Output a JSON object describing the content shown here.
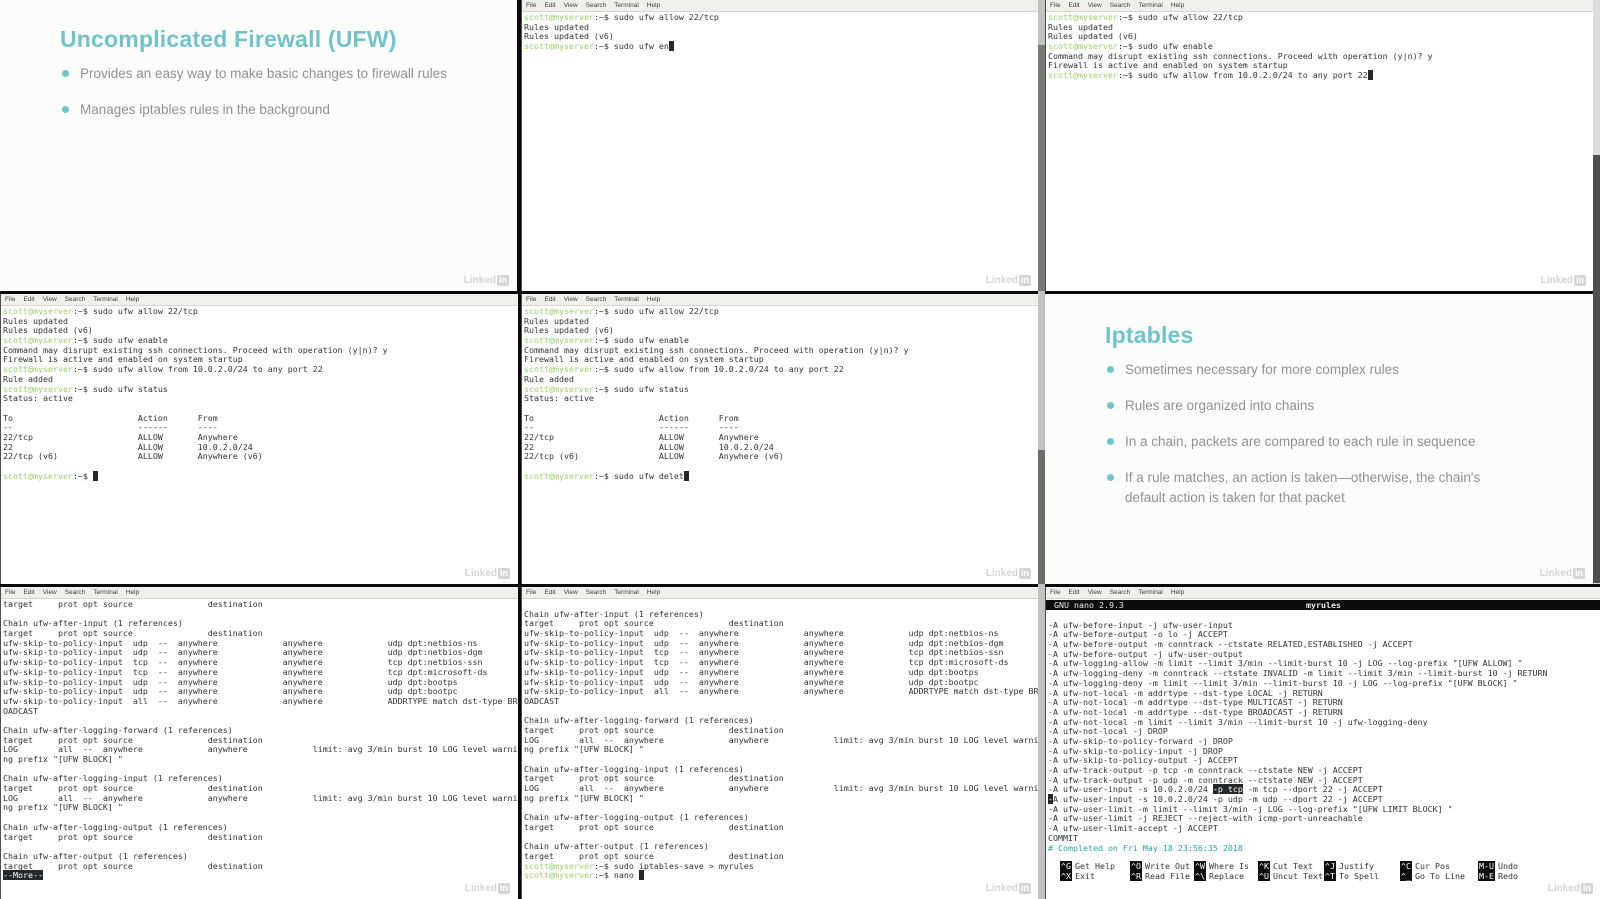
{
  "colors": {
    "slide_accent_teal": "#70c3cb",
    "prompt_green": "#9ccf6d",
    "nano_comment_teal": "#2aa6a0",
    "slide_body_gray": "#8d9292"
  },
  "watermark": {
    "text": "Linked",
    "badge": "in"
  },
  "menu": [
    "File",
    "Edit",
    "View",
    "Search",
    "Terminal",
    "Help"
  ],
  "slides": {
    "ufw": {
      "title": "Uncomplicated Firewall (UFW)",
      "bullets": [
        "Provides an easy way to make basic changes to firewall rules",
        "Manages iptables rules in the background"
      ]
    },
    "iptables": {
      "title": "Iptables",
      "bullets": [
        "Sometimes necessary for more complex rules",
        "Rules are organized into chains",
        "In a chain, packets are compared to each rule in sequence",
        "If a rule matches, an action is taken—otherwise, the chain's default action is taken for that packet"
      ]
    }
  },
  "terminals": {
    "t1": {
      "lines": [
        [
          {
            "t": "scott@myserver",
            "c": "g"
          },
          ":~$ sudo ufw allow 22/tcp"
        ],
        [
          "Rules updated"
        ],
        [
          "Rules updated (v6)"
        ],
        [
          {
            "t": "scott@myserver",
            "c": "g"
          },
          ":~$ sudo ufw en",
          {
            "t": " ",
            "c": "inv"
          }
        ]
      ]
    },
    "t2": {
      "lines": [
        [
          {
            "t": "scott@myserver",
            "c": "g"
          },
          ":~$ sudo ufw allow 22/tcp"
        ],
        [
          "Rules updated"
        ],
        [
          "Rules updated (v6)"
        ],
        [
          {
            "t": "scott@myserver",
            "c": "g"
          },
          ":~$ sudo ufw enable"
        ],
        [
          "Command may disrupt existing ssh connections. Proceed with operation (y|n)? y"
        ],
        [
          "Firewall is active and enabled on system startup"
        ],
        [
          {
            "t": "scott@myserver",
            "c": "g"
          },
          ":~$ sudo ufw allow from 10.0.2.0/24 to any port 22",
          {
            "t": " ",
            "c": "inv"
          }
        ]
      ]
    },
    "t3": {
      "lines": [
        [
          {
            "t": "scott@myserver",
            "c": "g"
          },
          ":~$ sudo ufw allow 22/tcp"
        ],
        [
          "Rules updated"
        ],
        [
          "Rules updated (v6)"
        ],
        [
          {
            "t": "scott@myserver",
            "c": "g"
          },
          ":~$ sudo ufw enable"
        ],
        [
          "Command may disrupt existing ssh connections. Proceed with operation (y|n)? y"
        ],
        [
          "Firewall is active and enabled on system startup"
        ],
        [
          {
            "t": "scott@myserver",
            "c": "g"
          },
          ":~$ sudo ufw allow from 10.0.2.0/24 to any port 22"
        ],
        [
          "Rule added"
        ],
        [
          {
            "t": "scott@myserver",
            "c": "g"
          },
          ":~$ sudo ufw status"
        ],
        [
          "Status: active"
        ],
        [],
        [
          "To                         Action      From"
        ],
        [
          "--                         ------      ----"
        ],
        [
          "22/tcp                     ALLOW       Anywhere"
        ],
        [
          "22                         ALLOW       10.0.2.0/24"
        ],
        [
          "22/tcp (v6)                ALLOW       Anywhere (v6)"
        ],
        [],
        [
          {
            "t": "scott@myserver",
            "c": "g"
          },
          ":~$ ",
          {
            "t": " ",
            "c": "inv"
          }
        ]
      ]
    },
    "t4": {
      "lines": [
        [
          {
            "t": "scott@myserver",
            "c": "g"
          },
          ":~$ sudo ufw allow 22/tcp"
        ],
        [
          "Rules updated"
        ],
        [
          "Rules updated (v6)"
        ],
        [
          {
            "t": "scott@myserver",
            "c": "g"
          },
          ":~$ sudo ufw enable"
        ],
        [
          "Command may disrupt existing ssh connections. Proceed with operation (y|n)? y"
        ],
        [
          "Firewall is active and enabled on system startup"
        ],
        [
          {
            "t": "scott@myserver",
            "c": "g"
          },
          ":~$ sudo ufw allow from 10.0.2.0/24 to any port 22"
        ],
        [
          "Rule added"
        ],
        [
          {
            "t": "scott@myserver",
            "c": "g"
          },
          ":~$ sudo ufw status"
        ],
        [
          "Status: active"
        ],
        [],
        [
          "To                         Action      From"
        ],
        [
          "--                         ------      ----"
        ],
        [
          "22/tcp                     ALLOW       Anywhere"
        ],
        [
          "22                         ALLOW       10.0.2.0/24"
        ],
        [
          "22/tcp (v6)                ALLOW       Anywhere (v6)"
        ],
        [],
        [
          {
            "t": "scott@myserver",
            "c": "g"
          },
          ":~$ sudo ufw delet",
          {
            "t": " ",
            "c": "inv"
          }
        ]
      ]
    },
    "t5": {
      "lines": [
        [
          "target     prot opt source               destination"
        ],
        [],
        [
          "Chain ufw-after-input (1 references)"
        ],
        [
          "target     prot opt source               destination"
        ],
        [
          "ufw-skip-to-policy-input  udp  --  anywhere             anywhere             udp dpt:netbios-ns"
        ],
        [
          "ufw-skip-to-policy-input  udp  --  anywhere             anywhere             udp dpt:netbios-dgm"
        ],
        [
          "ufw-skip-to-policy-input  tcp  --  anywhere             anywhere             tcp dpt:netbios-ssn"
        ],
        [
          "ufw-skip-to-policy-input  tcp  --  anywhere             anywhere             tcp dpt:microsoft-ds"
        ],
        [
          "ufw-skip-to-policy-input  udp  --  anywhere             anywhere             udp dpt:bootps"
        ],
        [
          "ufw-skip-to-policy-input  udp  --  anywhere             anywhere             udp dpt:bootpc"
        ],
        [
          "ufw-skip-to-policy-input  all  --  anywhere             anywhere             ADDRTYPE match dst-type BR"
        ],
        [
          "OADCAST"
        ],
        [],
        [
          "Chain ufw-after-logging-forward (1 references)"
        ],
        [
          "target     prot opt source               destination"
        ],
        [
          "LOG        all  --  anywhere             anywhere             limit: avg 3/min burst 10 LOG level warni"
        ],
        [
          "ng prefix \"[UFW BLOCK] \""
        ],
        [],
        [
          "Chain ufw-after-logging-input (1 references)"
        ],
        [
          "target     prot opt source               destination"
        ],
        [
          "LOG        all  --  anywhere             anywhere             limit: avg 3/min burst 10 LOG level warni"
        ],
        [
          "ng prefix \"[UFW BLOCK] \""
        ],
        [],
        [
          "Chain ufw-after-logging-output (1 references)"
        ],
        [
          "target     prot opt source               destination"
        ],
        [],
        [
          "Chain ufw-after-output (1 references)"
        ],
        [
          "target     prot opt source               destination"
        ],
        [
          {
            "t": "--More--",
            "c": "inv"
          }
        ]
      ]
    },
    "t6": {
      "lines": [
        [],
        [
          "Chain ufw-after-input (1 references)"
        ],
        [
          "target     prot opt source               destination"
        ],
        [
          "ufw-skip-to-policy-input  udp  --  anywhere             anywhere             udp dpt:netbios-ns"
        ],
        [
          "ufw-skip-to-policy-input  udp  --  anywhere             anywhere             udp dpt:netbios-dgm"
        ],
        [
          "ufw-skip-to-policy-input  tcp  --  anywhere             anywhere             tcp dpt:netbios-ssn"
        ],
        [
          "ufw-skip-to-policy-input  tcp  --  anywhere             anywhere             tcp dpt:microsoft-ds"
        ],
        [
          "ufw-skip-to-policy-input  udp  --  anywhere             anywhere             udp dpt:bootps"
        ],
        [
          "ufw-skip-to-policy-input  udp  --  anywhere             anywhere             udp dpt:bootpc"
        ],
        [
          "ufw-skip-to-policy-input  all  --  anywhere             anywhere             ADDRTYPE match dst-type BR"
        ],
        [
          "OADCAST"
        ],
        [],
        [
          "Chain ufw-after-logging-forward (1 references)"
        ],
        [
          "target     prot opt source               destination"
        ],
        [
          "LOG        all  --  anywhere             anywhere             limit: avg 3/min burst 10 LOG level warni"
        ],
        [
          "ng prefix \"[UFW BLOCK] \""
        ],
        [],
        [
          "Chain ufw-after-logging-input (1 references)"
        ],
        [
          "target     prot opt source               destination"
        ],
        [
          "LOG        all  --  anywhere             anywhere             limit: avg 3/min burst 10 LOG level warni"
        ],
        [
          "ng prefix \"[UFW BLOCK] \""
        ],
        [],
        [
          "Chain ufw-after-logging-output (1 references)"
        ],
        [
          "target     prot opt source               destination"
        ],
        [],
        [
          "Chain ufw-after-output (1 references)"
        ],
        [
          "target     prot opt source               destination"
        ],
        [
          {
            "t": "scott@myserver",
            "c": "g"
          },
          ":~$ sudo iptables-save > myrules"
        ],
        [
          {
            "t": "scott@myserver",
            "c": "g"
          },
          ":~$ nano ",
          {
            "t": " ",
            "c": "inv"
          }
        ]
      ]
    }
  },
  "nano": {
    "version_label": "GNU nano 2.9.3",
    "filename": "myrules",
    "lines": [
      [],
      [
        "-A ufw-before-input -j ufw-user-input"
      ],
      [
        "-A ufw-before-output -o lo -j ACCEPT"
      ],
      [
        "-A ufw-before-output -m conntrack --ctstate RELATED,ESTABLISHED -j ACCEPT"
      ],
      [
        "-A ufw-before-output -j ufw-user-output"
      ],
      [
        "-A ufw-logging-allow -m limit --limit 3/min --limit-burst 10 -j LOG --log-prefix \"[UFW ALLOW] \""
      ],
      [
        "-A ufw-logging-deny -m conntrack --ctstate INVALID -m limit --limit 3/min --limit-burst 10 -j RETURN"
      ],
      [
        "-A ufw-logging-deny -m limit --limit 3/min --limit-burst 10 -j LOG --log-prefix \"[UFW BLOCK] \""
      ],
      [
        "-A ufw-not-local -m addrtype --dst-type LOCAL -j RETURN"
      ],
      [
        "-A ufw-not-local -m addrtype --dst-type MULTICAST -j RETURN"
      ],
      [
        "-A ufw-not-local -m addrtype --dst-type BROADCAST -j RETURN"
      ],
      [
        "-A ufw-not-local -m limit --limit 3/min --limit-burst 10 -j ufw-logging-deny"
      ],
      [
        "-A ufw-not-local -j DROP"
      ],
      [
        "-A ufw-skip-to-policy-forward -j DROP"
      ],
      [
        "-A ufw-skip-to-policy-input -j DROP"
      ],
      [
        "-A ufw-skip-to-policy-output -j ACCEPT"
      ],
      [
        "-A ufw-track-output -p tcp -m conntrack --ctstate NEW -j ACCEPT"
      ],
      [
        "-A ufw-track-output -p udp -m conntrack --ctstate NEW -j ACCEPT"
      ],
      [
        "-A ufw-user-input -s 10.0.2.0/24 ",
        {
          "t": "-p tcp",
          "c": "inv"
        },
        " -m tcp --dport 22 -j ACCEPT"
      ],
      [
        {
          "t": "-",
          "c": "inv"
        },
        "A ufw-user-input -s 10.0.2.0/24 -p udp -m udp --dport 22 -j ACCEPT"
      ],
      [
        "-A ufw-user-limit -m limit --limit 3/min -j LOG --log-prefix \"[UFW LIMIT BLOCK] \""
      ],
      [
        "-A ufw-user-limit -j REJECT --reject-with icmp-port-unreachable"
      ],
      [
        "-A ufw-user-limit-accept -j ACCEPT"
      ],
      [
        "COMMIT"
      ],
      [
        {
          "t": "# Completed on Fri May 18 23:56:35 2018",
          "c": "teal"
        }
      ]
    ],
    "shortcuts": {
      "row1": [
        {
          "k": "^G",
          "label": "Get Help"
        },
        {
          "k": "^O",
          "label": "Write Out"
        },
        {
          "k": "^W",
          "label": "Where Is"
        },
        {
          "k": "^K",
          "label": "Cut Text"
        },
        {
          "k": "^J",
          "label": "Justify"
        },
        {
          "k": "^C",
          "label": "Cur Pos"
        },
        {
          "k": "M-U",
          "label": "Undo"
        }
      ],
      "row2": [
        {
          "k": "^X",
          "label": "Exit"
        },
        {
          "k": "^R",
          "label": "Read File"
        },
        {
          "k": "^\\",
          "label": "Replace"
        },
        {
          "k": "^U",
          "label": "Uncut Text"
        },
        {
          "k": "^T",
          "label": "To Spell"
        },
        {
          "k": "^_",
          "label": "Go To Line"
        },
        {
          "k": "M-E",
          "label": "Redo"
        }
      ]
    }
  }
}
